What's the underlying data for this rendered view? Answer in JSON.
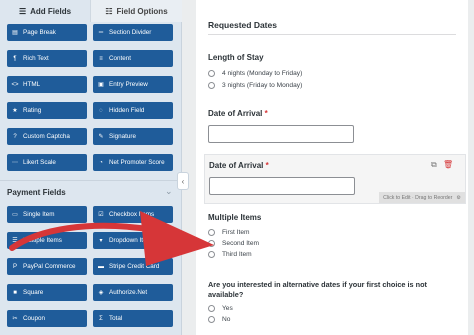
{
  "left_panel": {
    "tabs": [
      {
        "label": "Add Fields",
        "icon": "list-icon"
      },
      {
        "label": "Field Options",
        "icon": "sliders-icon"
      }
    ],
    "fancy_fields": [
      {
        "label": "Page Break",
        "icon": "page-break-icon"
      },
      {
        "label": "Section Divider",
        "icon": "divider-icon"
      },
      {
        "label": "Rich Text",
        "icon": "rich-text-icon"
      },
      {
        "label": "Content",
        "icon": "content-icon"
      },
      {
        "label": "HTML",
        "icon": "code-icon"
      },
      {
        "label": "Entry Preview",
        "icon": "preview-icon"
      },
      {
        "label": "Rating",
        "icon": "star-icon"
      },
      {
        "label": "Hidden Field",
        "icon": "eye-slash-icon"
      },
      {
        "label": "Custom Captcha",
        "icon": "captcha-icon"
      },
      {
        "label": "Signature",
        "icon": "pen-icon"
      },
      {
        "label": "Likert Scale",
        "icon": "likert-icon"
      },
      {
        "label": "Net Promoter Score",
        "icon": "gauge-icon"
      }
    ],
    "payment_section_title": "Payment Fields",
    "payment_fields": [
      {
        "label": "Single Item",
        "icon": "file-icon"
      },
      {
        "label": "Checkbox Items",
        "icon": "checkbox-icon"
      },
      {
        "label": "Multiple Items",
        "icon": "list-icon"
      },
      {
        "label": "Dropdown Items",
        "icon": "dropdown-icon"
      },
      {
        "label": "PayPal Commerce",
        "icon": "paypal-icon"
      },
      {
        "label": "Stripe Credit Card",
        "icon": "credit-card-icon"
      },
      {
        "label": "Square",
        "icon": "square-icon"
      },
      {
        "label": "Authorize.Net",
        "icon": "authorize-icon"
      },
      {
        "label": "Coupon",
        "icon": "coupon-icon"
      },
      {
        "label": "Total",
        "icon": "total-icon"
      }
    ]
  },
  "form": {
    "section_heading": "Requested Dates",
    "length_of_stay": {
      "label": "Length of Stay",
      "options": [
        "4 nights (Monday to Friday)",
        "3 nights (Friday to Monday)"
      ]
    },
    "date_of_arrival_1": {
      "label": "Date of Arrival",
      "required_mark": "*"
    },
    "date_of_arrival_2": {
      "label": "Date of Arrival",
      "required_mark": "*"
    },
    "drag_hint": "Click to Edit · Drag to Reorder",
    "multiple_items": {
      "label": "Multiple Items",
      "options": [
        "First Item",
        "Second Item",
        "Third Item"
      ]
    },
    "alt_dates": {
      "label": "Are you interested in alternative dates if your first choice is not available?",
      "options": [
        "Yes",
        "No"
      ]
    }
  },
  "colors": {
    "button_bg": "#1f5c9a",
    "arrow": "#d63638",
    "required": "#d63638"
  }
}
